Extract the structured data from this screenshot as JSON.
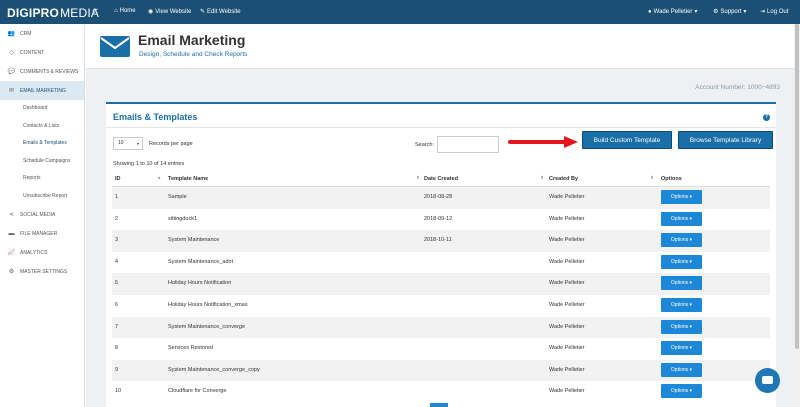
{
  "brand": {
    "name": "DIGIPRO",
    "suffix": "MEDIA",
    "collapse_glyph": "«"
  },
  "topbar": {
    "home_label": "Home",
    "view_website_label": "View Website",
    "edit_website_label": "Edit Website",
    "user_label": "Wade Pelletier",
    "support_label": "Support",
    "logout_label": "Log Out",
    "bg_color": "#1b4f74"
  },
  "sidebar": {
    "items": [
      {
        "label": "CRM",
        "icon": "users-icon"
      },
      {
        "label": "CONTENT",
        "icon": "diamond-icon"
      },
      {
        "label": "COMMENTS & REVIEWS",
        "icon": "comment-icon"
      },
      {
        "label": "EMAIL MARKETING",
        "icon": "envelope-icon"
      },
      {
        "label": "SOCIAL MEDIA",
        "icon": "share-icon"
      },
      {
        "label": "FILE MANAGER",
        "icon": "folder-icon"
      },
      {
        "label": "ANALYTICS",
        "icon": "chart-icon"
      },
      {
        "label": "MASTER SETTINGS",
        "icon": "gear-icon"
      }
    ],
    "email_sub": [
      "Dashboard",
      "Contacts & Lists",
      "Emails & Templates",
      "Schedule Campaigns",
      "Reports",
      "Unsubscribe Report"
    ]
  },
  "header": {
    "title": "Email Marketing",
    "subtitle": "Design, Schedule and Check Reports",
    "account_number": "Account Number: 1000−4893"
  },
  "panel": {
    "title": "Emails & Templates",
    "records_per_page_value": "10",
    "records_per_page_label": "Records per page",
    "search_label": "Search:",
    "build_button": "Build Custom Template",
    "browse_button": "Browse Template Library",
    "showing": "Showing 1 to 10 of 14 entries"
  },
  "table": {
    "columns": [
      "ID",
      "Template Name",
      "Date Created",
      "Created By",
      "Options"
    ],
    "rows": [
      {
        "id": "1",
        "name": "Sample",
        "date": "2018-08-28",
        "by": "Wade Pelletier",
        "options": "Options ▾"
      },
      {
        "id": "2",
        "name": "sittingduck1",
        "date": "2018-09-12",
        "by": "Wade Pelletier",
        "options": "Options ▾"
      },
      {
        "id": "3",
        "name": "System Maintenance",
        "date": "2018-10-11",
        "by": "Wade Pelletier",
        "options": "Options ▾"
      },
      {
        "id": "4",
        "name": "System Maintenance_adot",
        "date": "",
        "by": "Wade Pelletier",
        "options": "Options ▾"
      },
      {
        "id": "5",
        "name": "Holiday Hours Notification",
        "date": "",
        "by": "Wade Pelletier",
        "options": "Options ▾"
      },
      {
        "id": "6",
        "name": "Holiday Hours Notification_xmas",
        "date": "",
        "by": "Wade Pelletier",
        "options": "Options ▾"
      },
      {
        "id": "7",
        "name": "System Maintenance_converge",
        "date": "",
        "by": "Wade Pelletier",
        "options": "Options ▾"
      },
      {
        "id": "8",
        "name": "Services Restored",
        "date": "",
        "by": "Wade Pelletier",
        "options": "Options ▾"
      },
      {
        "id": "9",
        "name": "System Maintenance_converge_copy",
        "date": "",
        "by": "Wade Pelletier",
        "options": "Options ▾"
      },
      {
        "id": "10",
        "name": "Cloudflare for Converge",
        "date": "",
        "by": "Wade Pelletier",
        "options": "Options ▾"
      }
    ]
  },
  "colors": {
    "accent": "#1b6fa8",
    "option_button": "#1e88d8",
    "arrow": "#e8141b"
  }
}
